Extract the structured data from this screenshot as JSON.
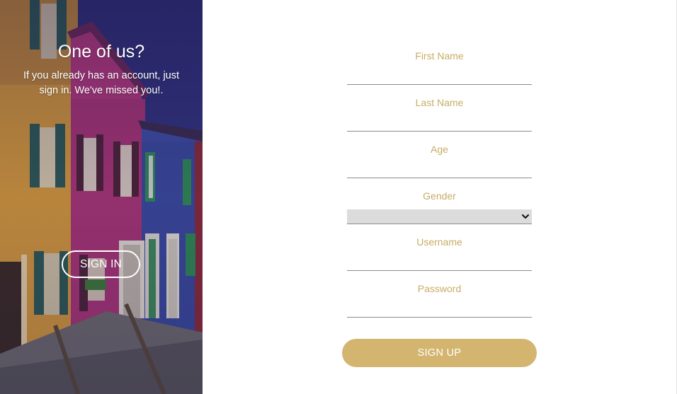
{
  "signin_panel": {
    "heading": "One of us?",
    "message": "If you already has an account, just sign in. We've missed you!.",
    "signin_label": "SIGN IN"
  },
  "signup_form": {
    "fields": [
      {
        "label": "First Name",
        "type": "text",
        "value": ""
      },
      {
        "label": "Last Name",
        "type": "text",
        "value": ""
      },
      {
        "label": "Age",
        "type": "text",
        "value": ""
      },
      {
        "label": "Gender",
        "type": "select",
        "value": ""
      },
      {
        "label": "Username",
        "type": "text",
        "value": ""
      },
      {
        "label": "Password",
        "type": "password",
        "value": ""
      }
    ],
    "signup_label": "SIGN UP"
  },
  "colors": {
    "accent_gold": "#d3b570",
    "label_gold": "#c9ac66",
    "underline": "#8c8c8c",
    "select_bg": "#dcdcdc"
  }
}
